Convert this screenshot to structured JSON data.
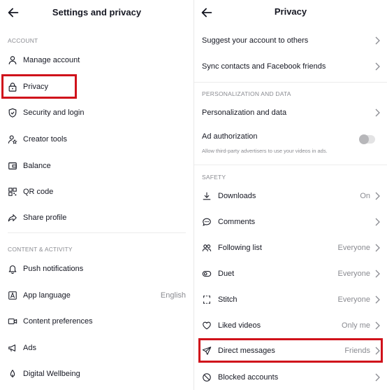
{
  "settings": {
    "title": "Settings and privacy",
    "account_header": "ACCOUNT",
    "account_items": [
      {
        "label": "Manage account",
        "icon": "person-icon"
      },
      {
        "label": "Privacy",
        "icon": "lock-icon"
      },
      {
        "label": "Security and login",
        "icon": "shield-check-icon"
      },
      {
        "label": "Creator tools",
        "icon": "person-star-icon"
      },
      {
        "label": "Balance",
        "icon": "wallet-icon"
      },
      {
        "label": "QR code",
        "icon": "qr-code-icon"
      },
      {
        "label": "Share profile",
        "icon": "share-icon"
      }
    ],
    "content_header": "CONTENT & ACTIVITY",
    "content_items": [
      {
        "label": "Push notifications",
        "icon": "bell-icon",
        "value": ""
      },
      {
        "label": "App language",
        "icon": "language-icon",
        "value": "English"
      },
      {
        "label": "Content preferences",
        "icon": "video-icon",
        "value": ""
      },
      {
        "label": "Ads",
        "icon": "megaphone-icon",
        "value": ""
      },
      {
        "label": "Digital Wellbeing",
        "icon": "wellbeing-icon",
        "value": ""
      }
    ]
  },
  "privacy": {
    "title": "Privacy",
    "top_items": [
      {
        "label": "Suggest your account to others"
      },
      {
        "label": "Sync contacts and Facebook friends"
      }
    ],
    "personalization_header": "PERSONALIZATION AND DATA",
    "personalization_item": "Personalization and data",
    "ad_authorization": {
      "label": "Ad authorization",
      "description": "Allow third-party advertisers to use your videos in ads.",
      "enabled": false
    },
    "safety_header": "SAFETY",
    "safety_items": [
      {
        "label": "Downloads",
        "value": "On",
        "icon": "download-icon"
      },
      {
        "label": "Comments",
        "value": "",
        "icon": "comment-icon"
      },
      {
        "label": "Following list",
        "value": "Everyone",
        "icon": "people-icon"
      },
      {
        "label": "Duet",
        "value": "Everyone",
        "icon": "duet-icon"
      },
      {
        "label": "Stitch",
        "value": "Everyone",
        "icon": "stitch-icon"
      },
      {
        "label": "Liked videos",
        "value": "Only me",
        "icon": "heart-icon"
      },
      {
        "label": "Direct messages",
        "value": "Friends",
        "icon": "send-icon"
      },
      {
        "label": "Blocked accounts",
        "value": "",
        "icon": "block-icon"
      }
    ]
  },
  "colors": {
    "highlight": "#d0121b",
    "text": "#161823",
    "secondary": "#8a8b91"
  }
}
